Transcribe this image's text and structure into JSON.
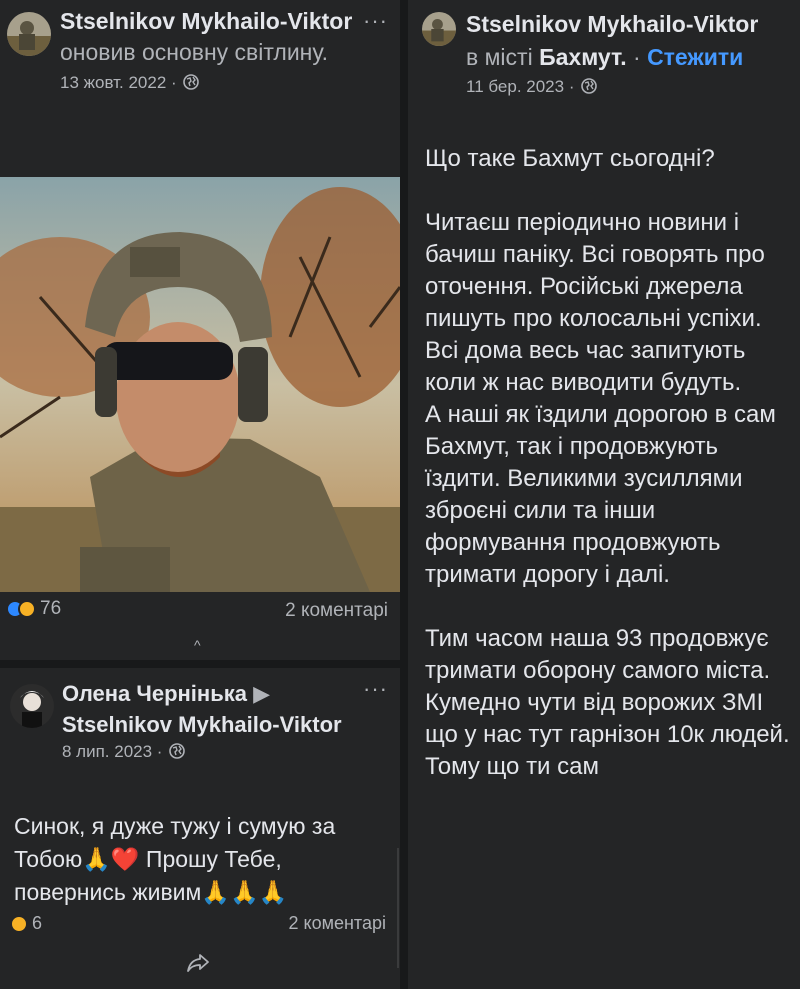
{
  "post1": {
    "author": "Stselnikov Mykhailo-Viktor",
    "action": "оновив основну світлину.",
    "date": "13 жовт. 2022 ·",
    "reactions_count": "76",
    "comments": "2 коментарі",
    "more_label": "···",
    "caret": "^"
  },
  "comment": {
    "author": "Олена Чернінька",
    "arrow": "▶",
    "target": "Stselnikov Mykhailo-Viktor",
    "date": "8 лип. 2023 ·",
    "text": "Синок, я дуже тужу і сумую за Тобою🙏❤️ Прошу Тебе, повернись живим🙏🙏🙏",
    "reactions_count": "6",
    "comments": "2 коментарі",
    "more_label": "···"
  },
  "post2": {
    "author": "Stselnikov Mykhailo-Viktor",
    "location_prefix": "в місті",
    "location": "Бахмут.",
    "separator": "·",
    "follow": "Стежити",
    "date": "11 бер. 2023 ·",
    "more_label": "···",
    "paragraphs": [
      "Що таке Бахмут сьогодні?",
      "",
      "Читаєш періодично новини і бачиш паніку. Всі говорять про оточення. Російські джерела пишуть про колосальні успіхи. Всі дома весь час запитують коли ж нас виводити будуть.",
      "А наші як їздили дорогою в сам Бахмут, так і продовжують їздити. Великими зусиллями зброєні сили та інши формування продовжують тримати дорогу і далі.",
      "",
      "Тим часом наша 93 продовжує тримати оборону самого міста. Кумедно чути від ворожих ЗМІ що у нас тут гарнізон 10к людей. Тому що ти сам"
    ]
  },
  "colors": {
    "background": "#18191a",
    "panel": "#242526",
    "text": "#e4e6eb",
    "secondary": "#b0b3b8",
    "link": "#4599ff"
  }
}
